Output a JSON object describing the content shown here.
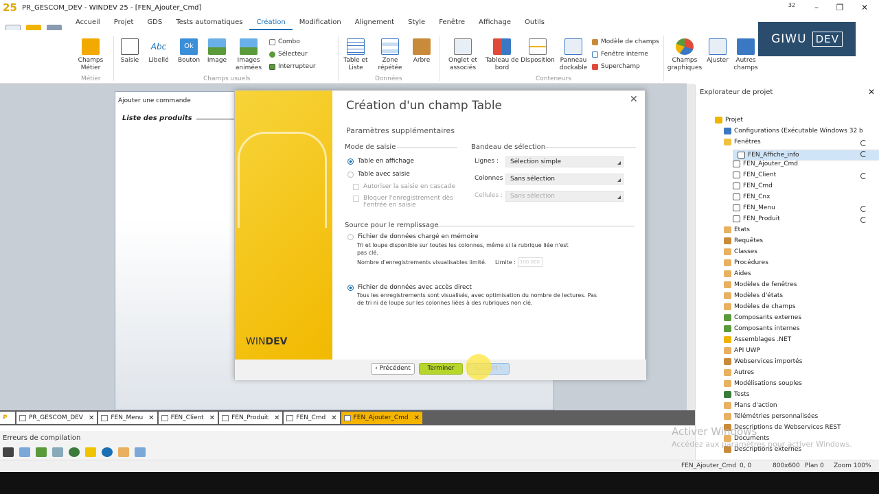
{
  "window": {
    "title": "PR_GESCOM_DEV - WINDEV 25 - [FEN_Ajouter_Cmd]",
    "corner_number": "32"
  },
  "menu_tabs": [
    "Accueil",
    "Projet",
    "GDS",
    "Tests automatiques",
    "Création",
    "Modification",
    "Alignement",
    "Style",
    "Fenêtre",
    "Affichage",
    "Outils"
  ],
  "ribbon": {
    "champs_metier": "Champs\nMétier",
    "saisie": "Saisie",
    "libelle": "Libellé",
    "bouton": "Bouton",
    "image": "Image",
    "images_animees": "Images\nanimées",
    "combo": "Combo",
    "selecteur": "Sélecteur",
    "interrupteur": "Interrupteur",
    "table_liste": "Table et\nListe",
    "zone_repetee": "Zone\nrépétée",
    "arbre": "Arbre",
    "onglet": "Onglet et\nassociés",
    "tableau_bord": "Tableau de\nbord",
    "disposition": "Disposition",
    "panneau": "Panneau\ndockable",
    "modele_champs": "Modèle de champs",
    "fenetre_interne": "Fenêtre interne",
    "superchamp": "Superchamp",
    "champs_graphiques": "Champs\ngraphiques",
    "ajuster": "Ajuster",
    "autres_champs": "Autres\nchamps",
    "g_metier": "Métier",
    "g_usuels": "Champs usuels",
    "g_donnees": "Données",
    "g_conteneurs": "Conteneurs",
    "abc": "Abc",
    "ok": "Ok"
  },
  "banner": {
    "left": "GIWU",
    "right": "DEV"
  },
  "editor": {
    "command": "Ajouter une commande",
    "label": "Liste des produits"
  },
  "dialog": {
    "title": "Création d'un champ Table",
    "subtitle": "Paramètres supplémentaires",
    "brand_a": "WIN",
    "brand_b": "DEV",
    "mode_saisie": "Mode de saisie",
    "table_affichage": "Table en affichage",
    "table_saisie": "Table avec saisie",
    "cascade": "Autoriser la saisie en cascade",
    "bloquer": "Bloquer l'enregistrement dès l'entrée en saisie",
    "bandeau": "Bandeau de sélection",
    "lignes_lbl": "Lignes :",
    "lignes_val": "Sélection simple",
    "colonnes_lbl": "Colonnes :",
    "colonnes_val": "Sans sélection",
    "cellules_lbl": "Cellules :",
    "cellules_val": "Sans sélection",
    "source": "Source pour le remplissage",
    "memoire": "Fichier de données chargé en mémoire",
    "memoire_desc": "Tri et loupe disponible sur toutes les colonnes, même si la rubrique liée n'est pas clé.",
    "nb_enreg": "Nombre d'enregistrements visualisables limité.",
    "limite_lbl": "Limite :",
    "limite_val": "100 000",
    "direct": "Fichier de données avec accès direct",
    "direct_desc": "Tous les enregistrements sont visualisés, avec optimisation du nombre de lectures. Pas de tri ni de loupe sur les colonnes liées à des rubriques non clé.",
    "btn_prev": "Précédent",
    "btn_finish": "Terminer",
    "btn_next": "Suivant"
  },
  "bottom_tabs": [
    "PR_GESCOM_DEV",
    "FEN_Menu",
    "FEN_Client",
    "FEN_Produit",
    "FEN_Cmd",
    "FEN_Ajouter_Cmd"
  ],
  "errors": {
    "title": "Erreurs de compilation"
  },
  "explorer": {
    "title": "Explorateur de projet",
    "items": [
      "Projet",
      "Configurations (Exécutable Windows 32 b",
      "Fenêtres",
      "FEN_Affiche_info",
      "FEN_Ajouter_Cmd",
      "FEN_Client",
      "FEN_Cmd",
      "FEN_Cnx",
      "FEN_Menu",
      "FEN_Produit",
      "Etats",
      "Requêtes",
      "Classes",
      "Procédures",
      "Aides",
      "Modèles de fenêtres",
      "Modèles d'états",
      "Modèles de champs",
      "Composants externes",
      "Composants internes",
      "Assemblages .NET",
      "API UWP",
      "Webservices importés",
      "Autres",
      "Modélisations souples",
      "Tests",
      "Plans d'action",
      "Télémétries personnalisées",
      "Descriptions de Webservices REST",
      "Documents",
      "Descriptions externes"
    ]
  },
  "watermark": {
    "line1": "Activer Windows",
    "line2": "Accédez aux paramètres pour activer Windows."
  },
  "status": {
    "window": "FEN_Ajouter_Cmd",
    "pos": "0, 0",
    "size": "800x600",
    "plan": "Plan 0",
    "zoom": "Zoom 100%"
  },
  "colors": {
    "accent": "#1a6fb5",
    "yellow": "#f4b400",
    "finish": "#b7d62c"
  }
}
